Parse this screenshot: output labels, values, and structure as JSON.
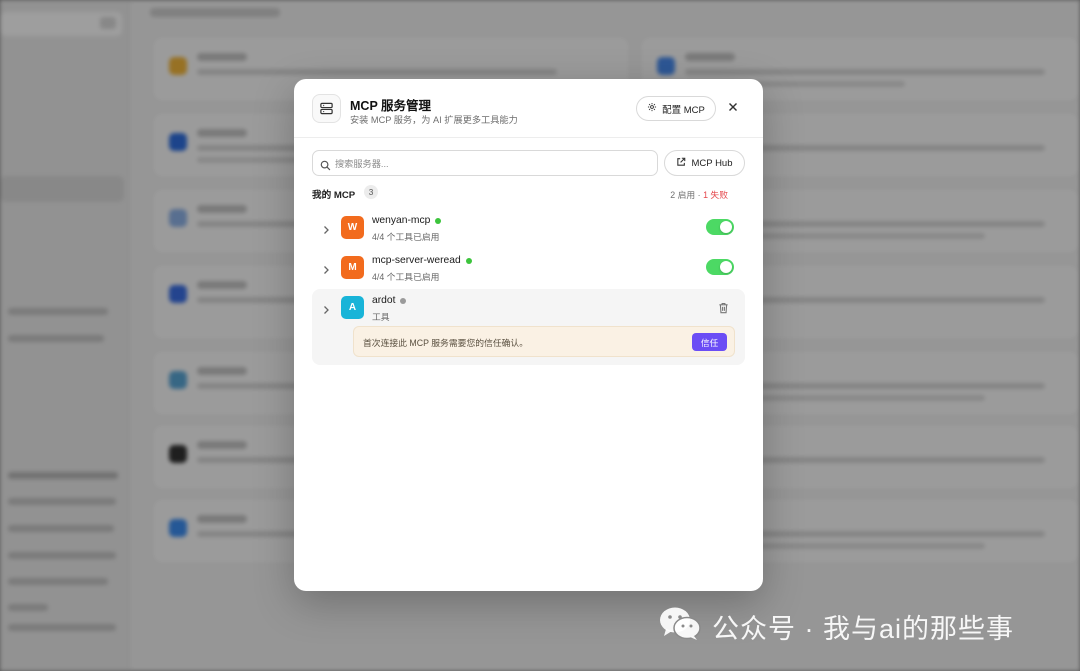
{
  "modal": {
    "title": "MCP 服务管理",
    "subtitle": "安装 MCP 服务，为 AI 扩展更多工具能力",
    "config_button": "配置 MCP",
    "search_placeholder": "搜索服务器...",
    "hub_button": "MCP Hub",
    "section_label": "我的 MCP",
    "section_count": "3",
    "status_enabled": "2 启用",
    "status_separator": " · ",
    "status_failed": "1 失败",
    "servers": [
      {
        "avatar": "W",
        "name": "wenyan-mcp",
        "desc": "4/4 个工具已启用",
        "status": "online",
        "enabled": true,
        "avatar_color": "#f26b1d"
      },
      {
        "avatar": "M",
        "name": "mcp-server-weread",
        "desc": "4/4 个工具已启用",
        "status": "online",
        "enabled": true,
        "avatar_color": "#f26b1d"
      },
      {
        "avatar": "A",
        "name": "ardot",
        "desc": "工具",
        "status": "offline",
        "avatar_color": "#18b4d8",
        "trust_message": "首次连接此 MCP 服务需要您的信任确认。",
        "trust_button": "信任"
      }
    ]
  },
  "watermark": {
    "text": "公众号 · 我与ai的那些事"
  },
  "colors": {
    "toggle_on": "#4cd964",
    "online_dot": "#3cc43c",
    "offline_dot": "#9a9a9a",
    "fail_text": "#e5484d",
    "trust_button": "#6b4df5"
  }
}
